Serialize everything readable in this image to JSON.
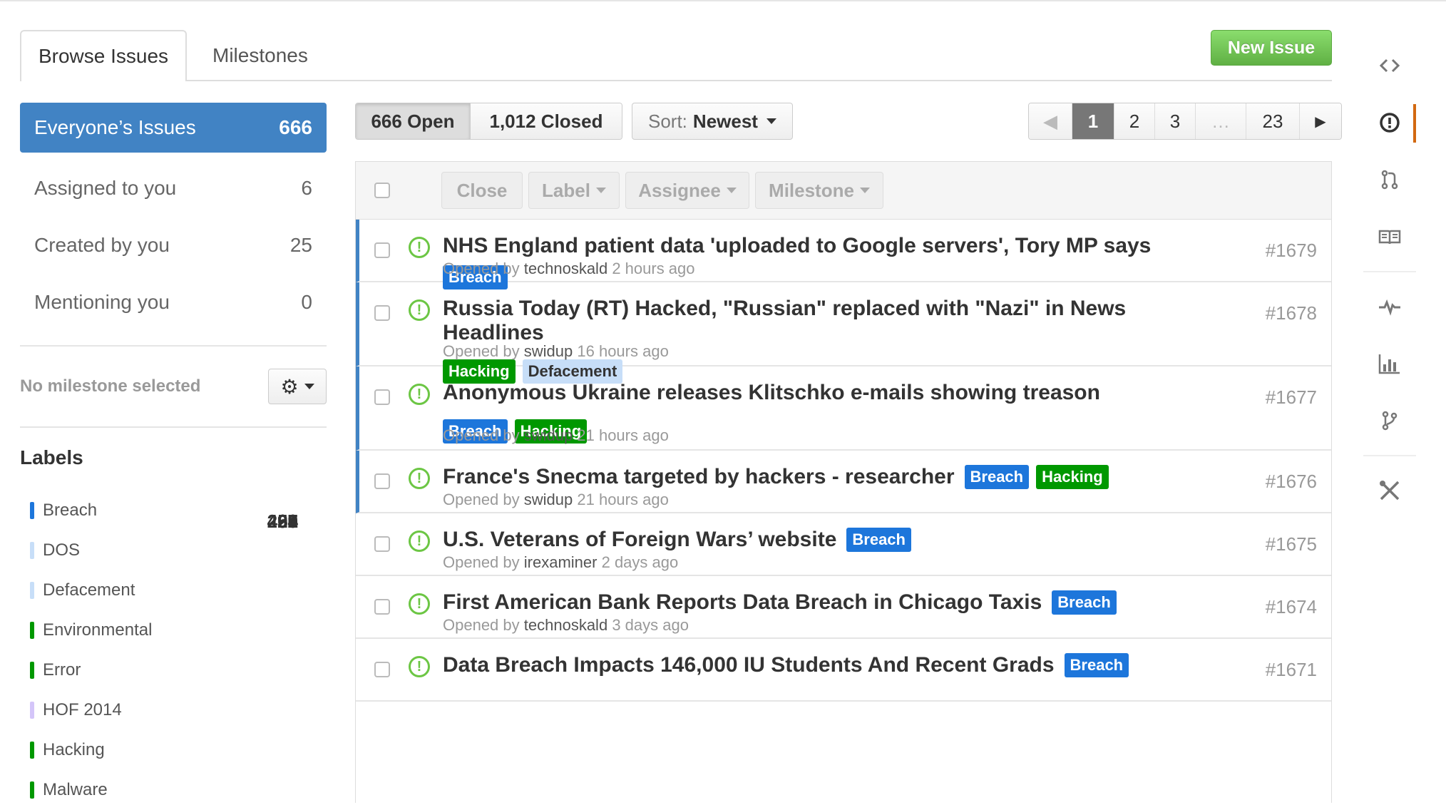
{
  "tabs": [
    {
      "label": "Browse Issues"
    },
    {
      "label": "Milestones"
    }
  ],
  "new_issue_label": "New Issue",
  "filters": [
    {
      "label": "Everyone’s Issues",
      "count": "666"
    },
    {
      "label": "Assigned to you",
      "count": "6"
    },
    {
      "label": "Created by you",
      "count": "25"
    },
    {
      "label": "Mentioning you",
      "count": "0"
    }
  ],
  "milestone_text": "No milestone selected",
  "labels_title": "Labels",
  "labels": [
    {
      "name": "Breach",
      "count": "499",
      "color": "#1d76db"
    },
    {
      "name": "DOS",
      "count": "37",
      "color": "#c7def8"
    },
    {
      "name": "Defacement",
      "count": "50",
      "color": "#c7def8"
    },
    {
      "name": "Environmental",
      "count": "1",
      "color": "#009800"
    },
    {
      "name": "Error",
      "count": "65",
      "color": "#009800"
    },
    {
      "name": "HOF 2014",
      "count": "2",
      "color": "#d4c5f9"
    },
    {
      "name": "Hacking",
      "count": "222",
      "color": "#009800"
    },
    {
      "name": "Malware",
      "count": "34",
      "color": "#009800"
    }
  ],
  "state_toggle": {
    "open": "666 Open",
    "closed": "1,012 Closed"
  },
  "sort": {
    "label": "Sort:",
    "value": "Newest"
  },
  "pagination": {
    "prev": "◀",
    "pages": [
      "1",
      "2",
      "3",
      "…",
      "23"
    ],
    "next": "▶",
    "current": "1"
  },
  "bulk_actions": [
    "Close",
    "Label",
    "Assignee",
    "Milestone"
  ],
  "issues": [
    {
      "title": "NHS England patient data 'uploaded to Google servers', Tory MP says",
      "labels": [
        "Breach"
      ],
      "opened_by": "Opened by",
      "user": "technoskald",
      "time": "2 hours ago",
      "number": "#1679",
      "unread": true
    },
    {
      "title": "Russia Today (RT) Hacked, \"Russian\" replaced with \"Nazi\" in News Headlines",
      "labels": [
        "Hacking",
        "Defacement"
      ],
      "opened_by": "Opened by",
      "user": "swidup",
      "time": "16 hours ago",
      "number": "#1678",
      "unread": true
    },
    {
      "title": "Anonymous Ukraine releases Klitschko e-mails showing treason",
      "labels": [
        "Breach",
        "Hacking"
      ],
      "opened_by": "Opened by",
      "user": "swidup",
      "time": "21 hours ago",
      "number": "#1677",
      "unread": true
    },
    {
      "title": "France's Snecma targeted by hackers - researcher",
      "labels": [
        "Breach",
        "Hacking"
      ],
      "opened_by": "Opened by",
      "user": "swidup",
      "time": "21 hours ago",
      "number": "#1676",
      "unread": true
    },
    {
      "title": "U.S. Veterans of Foreign Wars’ website",
      "labels": [
        "Breach"
      ],
      "opened_by": "Opened by",
      "user": "irexaminer",
      "time": "2 days ago",
      "number": "#1675",
      "unread": false
    },
    {
      "title": "First American Bank Reports Data Breach in Chicago Taxis",
      "labels": [
        "Breach"
      ],
      "opened_by": "Opened by",
      "user": "technoskald",
      "time": "3 days ago",
      "number": "#1674",
      "unread": false
    },
    {
      "title": "Data Breach Impacts 146,000 IU Students And Recent Grads",
      "labels": [
        "Breach"
      ],
      "opened_by": "",
      "user": "",
      "time": "",
      "number": "#1671",
      "unread": false
    }
  ],
  "rail_icons": [
    "code-icon",
    "issues-icon",
    "pull-request-icon",
    "wiki-icon",
    "pulse-icon",
    "graphs-icon",
    "network-icon",
    "settings-icon"
  ],
  "colors": {
    "accent": "#4183c4",
    "new_issue": "#60b044",
    "open_icon": "#6cc644",
    "rail_active": "#d26911"
  }
}
